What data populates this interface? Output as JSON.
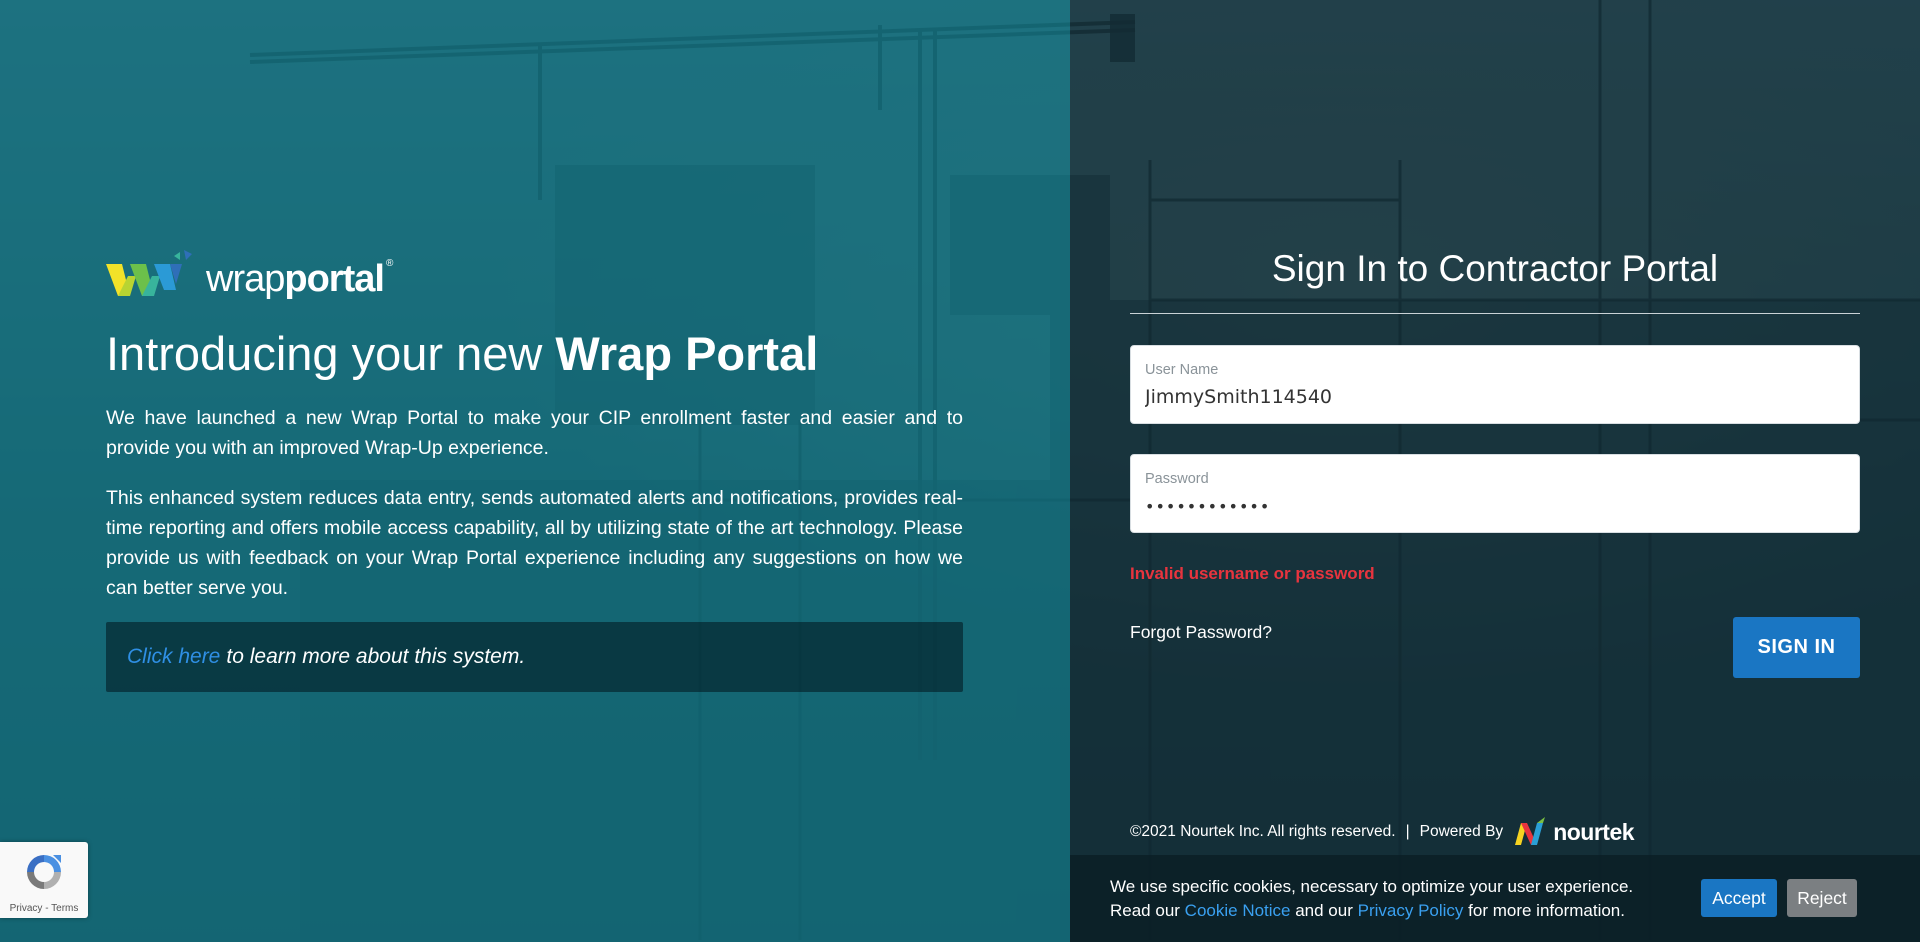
{
  "brand": {
    "logo_word_regular": "wrap",
    "logo_word_bold": "portal",
    "logo_mark": "®"
  },
  "intro": {
    "headline_prefix": "Introducing your new ",
    "headline_bold": "Wrap Portal",
    "paragraph_1": "We have launched a new Wrap Portal to make your CIP enrollment faster and easier and to provide you with an improved Wrap-Up experience.",
    "paragraph_2": "This enhanced system reduces data entry, sends automated alerts and notifications, provides real-time reporting and offers mobile access capability, all by utilizing state of the art technology. Please provide us with feedback on your Wrap Portal experience including any suggestions on how we can better serve you.",
    "learn_more_link": "Click here",
    "learn_more_text": "to learn more about this system."
  },
  "signin": {
    "title": "Sign In to Contractor Portal",
    "username_label": "User Name",
    "username_value": "JimmySmith114540",
    "password_label": "Password",
    "password_value": "••••••••••••",
    "error": "Invalid username or password",
    "forgot_link": "Forgot Password?",
    "submit_label": "SIGN IN"
  },
  "footer": {
    "copyright": "©2021 Nourtek Inc. All rights reserved.",
    "divider": "|",
    "powered_by": "Powered By",
    "nourtek_logo_text": "nourtek"
  },
  "cookie_banner": {
    "line1": "We use specific cookies, necessary to optimize your user experience.",
    "line2_prefix": "Read our ",
    "cookie_notice_link": "Cookie Notice",
    "line2_middle": " and our ",
    "privacy_policy_link": "Privacy Policy",
    "line2_suffix": " for more information.",
    "accept_label": "Accept",
    "reject_label": "Reject"
  },
  "recaptcha": {
    "privacy_link": "Privacy",
    "separator": " - ",
    "terms_link": "Terms"
  },
  "colors": {
    "left_overlay": "#0e7484",
    "primary_button": "#1a76c3",
    "error": "#e8343e",
    "link": "#2f8fe4",
    "reject_button": "#7b7f82"
  },
  "icons": [
    "wrapportal-logo-icon",
    "nourtek-logo-icon",
    "recaptcha-icon"
  ]
}
